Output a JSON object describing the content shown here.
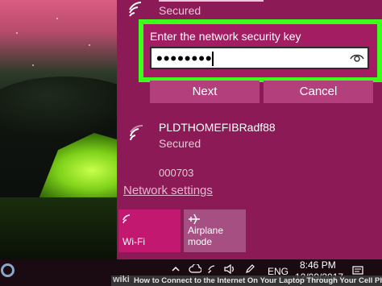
{
  "networks": [
    {
      "name": "",
      "status": "Secured"
    },
    {
      "name": "PLDTHOMEFIBRadf88",
      "status": "Secured"
    },
    {
      "name": "000703",
      "status": ""
    }
  ],
  "key_prompt": {
    "label": "Enter the network security key",
    "value": "••••••••"
  },
  "buttons": {
    "next": "Next",
    "cancel": "Cancel"
  },
  "network_settings": "Network settings",
  "tiles": [
    {
      "label": "Wi-Fi",
      "icon": "wifi-icon",
      "active": true
    },
    {
      "label": "Airplane mode",
      "icon": "airplane-icon",
      "active": false
    }
  ],
  "taskbar": {
    "language": "ENG",
    "time": "8:46 PM",
    "date": "12/09/2017"
  },
  "watermark": {
    "brand": "wiki",
    "caption": "How to Connect to the Internet On Your Laptop Through Your Cell Phone"
  },
  "colors": {
    "flyout_bg": "#8b1a56",
    "accent": "#c2186f",
    "highlight": "#3cff1b"
  }
}
